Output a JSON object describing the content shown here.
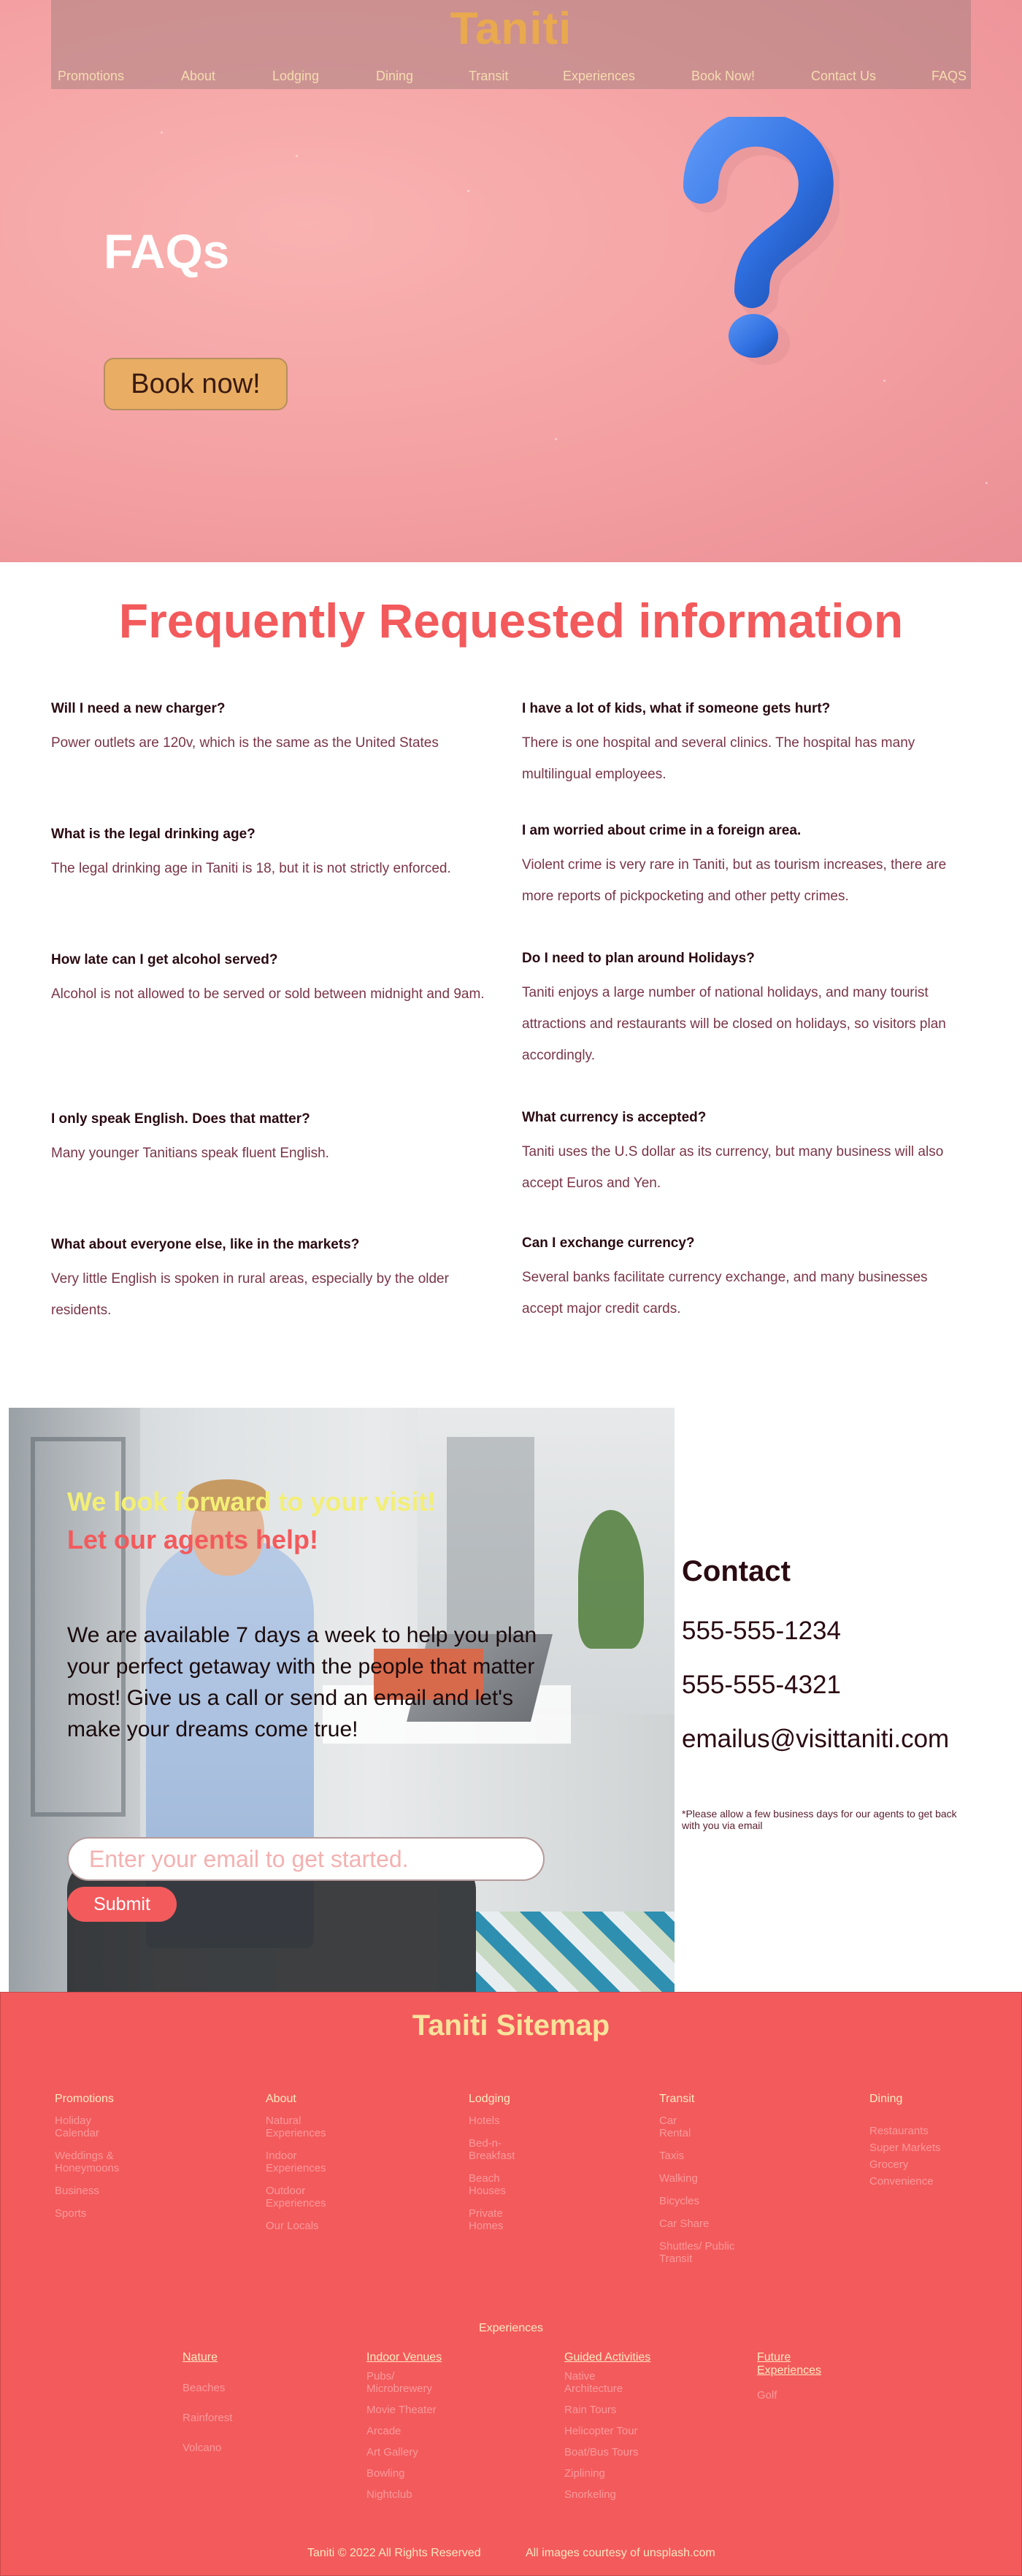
{
  "header": {
    "brand": "Taniti",
    "nav": [
      "Promotions",
      "About",
      "Lodging",
      "Dining",
      "Transit",
      "Experiences",
      "Book Now!",
      "Contact Us",
      "FAQS"
    ]
  },
  "hero": {
    "title": "FAQs",
    "cta": "Book now!"
  },
  "faq": {
    "heading": "Frequently Requested information",
    "left": [
      {
        "q": "Will I need a new charger?",
        "a": "Power outlets are 120v, which is the same as the United States"
      },
      {
        "q": "What is the legal drinking age?",
        "a": "The legal drinking age in Taniti is 18, but it is not strictly enforced."
      },
      {
        "q": "How late can I get alcohol served?",
        "a": "Alcohol is not allowed to be served or sold between midnight and 9am."
      },
      {
        "q": "I only speak English. Does that matter?",
        "a": "Many younger Tanitians speak fluent English."
      },
      {
        "q": "What about everyone else, like in the markets?",
        "a": "Very little English is spoken in rural areas, especially by the older residents."
      }
    ],
    "right": [
      {
        "q": "I have a lot of kids, what if someone gets hurt?",
        "a": "There is one hospital and several clinics. The hospital has many multilingual employees."
      },
      {
        "q": "I am worried about crime in a foreign area.",
        "a": "Violent crime is very rare in Taniti, but as tourism increases, there are more reports of pickpocketing and other petty crimes."
      },
      {
        "q": "Do I need to plan around Holidays?",
        "a": "Taniti enjoys a large number of national holidays, and many tourist attractions and restaurants will be closed on holidays, so visitors plan accordingly."
      },
      {
        "q": "What currency is accepted?",
        "a": "Taniti uses the U.S dollar as its currency, but many business will also accept Euros and Yen."
      },
      {
        "q": "Can I exchange currency?",
        "a": "Several banks facilitate currency exchange, and many businesses accept major credit cards."
      }
    ]
  },
  "visit": {
    "line1": "We look forward to your visit!",
    "line2": "Let our agents help!",
    "body": "We are available 7 days a week to help you plan your perfect getaway with the people that matter most! Give us a call or send an email and let's make your dreams come true!",
    "email_placeholder": "Enter your email to get started.",
    "submit": "Submit"
  },
  "contact": {
    "title": "Contact",
    "phone1": "555-555-1234",
    "phone2": "555-555-4321",
    "email": "emailus@visittaniti.com",
    "note": "*Please allow a few business days for our agents to get back with you via email"
  },
  "footer": {
    "title": "Taniti Sitemap",
    "columns": [
      {
        "head": "Promotions",
        "items": [
          "Holiday Calendar",
          "Weddings & Honeymoons",
          "Business",
          "Sports"
        ]
      },
      {
        "head": "About",
        "items": [
          "Natural Experiences",
          "Indoor Experiences",
          "Outdoor Experiences",
          "Our Locals"
        ]
      },
      {
        "head": "Lodging",
        "items": [
          "Hotels",
          "Bed-n-Breakfast",
          "Beach Houses",
          "Private Homes"
        ]
      },
      {
        "head": "Transit",
        "items": [
          "Car Rental",
          "Taxis",
          "Walking",
          "Bicycles",
          "Car Share",
          "Shuttles/ Public Transit"
        ]
      },
      {
        "head": "Dining",
        "items": [
          "Restaurants",
          "Super Markets",
          "Grocery",
          "Convenience"
        ]
      }
    ],
    "experiences_title": "Experiences",
    "experiences": [
      {
        "head": "Nature",
        "items": [
          "Beaches",
          "Rainforest",
          "Volcano"
        ]
      },
      {
        "head": "Indoor Venues",
        "items": [
          "Pubs/ Microbrewery",
          "Movie Theater",
          "Arcade",
          "Art Gallery",
          "Bowling",
          "Nightclub"
        ]
      },
      {
        "head": "Guided Activities",
        "items": [
          "Native Architecture",
          "Rain Tours",
          "Helicopter Tour",
          "Boat/Bus Tours",
          "Ziplining",
          "Snorkeling"
        ]
      },
      {
        "head": "Future Experiences",
        "items": [
          "Golf"
        ]
      }
    ],
    "copyright": "Taniti © 2022 All Rights Reserved",
    "credits": "All images courtesy of unsplash.com"
  },
  "colors": {
    "accent": "#f35a5c",
    "brand": "#e8a94f",
    "hero_bg": "#f4a0a2",
    "question_mark": "#2f6fe0"
  }
}
